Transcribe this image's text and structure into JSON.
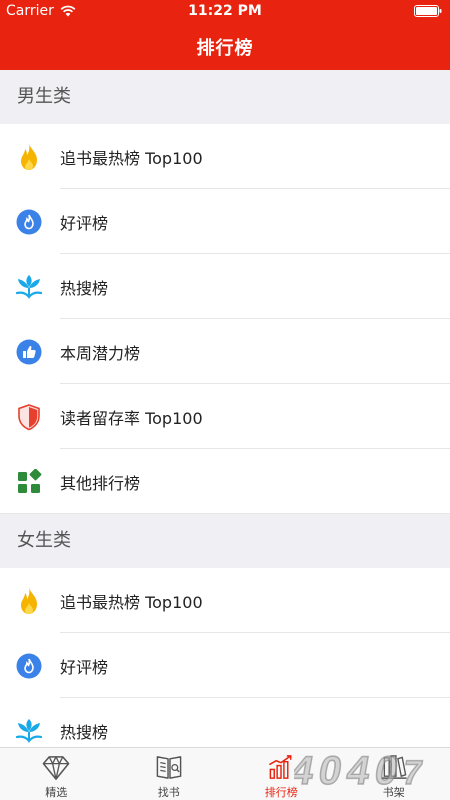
{
  "status_bar": {
    "carrier": "Carrier",
    "time": "11:22 PM"
  },
  "nav": {
    "title": "排行榜"
  },
  "sections": [
    {
      "title": "男生类",
      "items": [
        {
          "label": "追书最热榜 Top100",
          "icon": "flame-icon"
        },
        {
          "label": "好评榜",
          "icon": "blue-flame-icon"
        },
        {
          "label": "热搜榜",
          "icon": "lotus-icon"
        },
        {
          "label": "本周潜力榜",
          "icon": "thumbs-up-icon"
        },
        {
          "label": "读者留存率 Top100",
          "icon": "shield-icon"
        },
        {
          "label": "其他排行榜",
          "icon": "grid-icon"
        }
      ]
    },
    {
      "title": "女生类",
      "items": [
        {
          "label": "追书最热榜 Top100",
          "icon": "flame-icon"
        },
        {
          "label": "好评榜",
          "icon": "blue-flame-icon"
        },
        {
          "label": "热搜榜",
          "icon": "lotus-icon"
        }
      ]
    }
  ],
  "tabbar": {
    "tabs": [
      {
        "label": "精选",
        "icon": "diamond-icon"
      },
      {
        "label": "找书",
        "icon": "book-icon"
      },
      {
        "label": "排行榜",
        "icon": "chart-icon",
        "active": true
      },
      {
        "label": "书架",
        "icon": "bookshelf-icon"
      }
    ]
  },
  "colors": {
    "brand_red": "#e8230f",
    "section_bg": "#efeff4",
    "icon_blue": "#3b82e8",
    "icon_yellow": "#f5b400",
    "icon_cyan": "#1aa9e8",
    "icon_green": "#2e8b3a"
  }
}
